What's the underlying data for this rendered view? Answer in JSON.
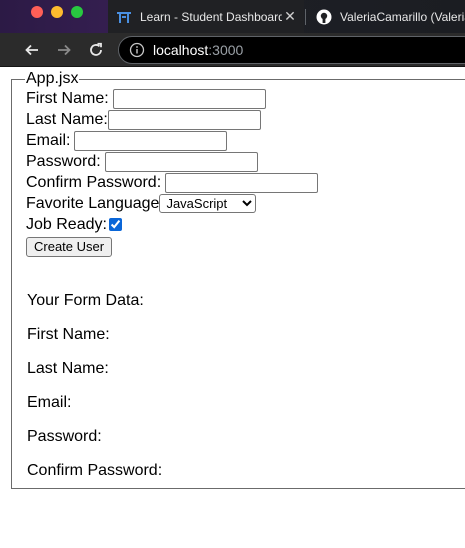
{
  "browser": {
    "tabs": [
      {
        "title": "Learn - Student Dashboard",
        "icon": "learn-icon"
      },
      {
        "title": "ValeriaCamarillo (Valeria",
        "icon": "github-icon"
      }
    ],
    "url_host": "localhost",
    "url_port": ":3000"
  },
  "form": {
    "legend": "App.jsx",
    "first_name_label": "First Name:",
    "last_name_label": "Last Name:",
    "email_label": "Email:",
    "password_label": "Password:",
    "confirm_password_label": "Confirm Password:",
    "favorite_language_label": "Favorite Language",
    "favorite_language_value": "JavaScript",
    "job_ready_label": "Job Ready:",
    "job_ready_checked": true,
    "submit_label": "Create User"
  },
  "output": {
    "heading": "Your Form Data:",
    "first_name": "First Name:",
    "last_name": "Last Name:",
    "email": "Email:",
    "password": "Password:",
    "confirm_password": "Confirm Password:"
  }
}
